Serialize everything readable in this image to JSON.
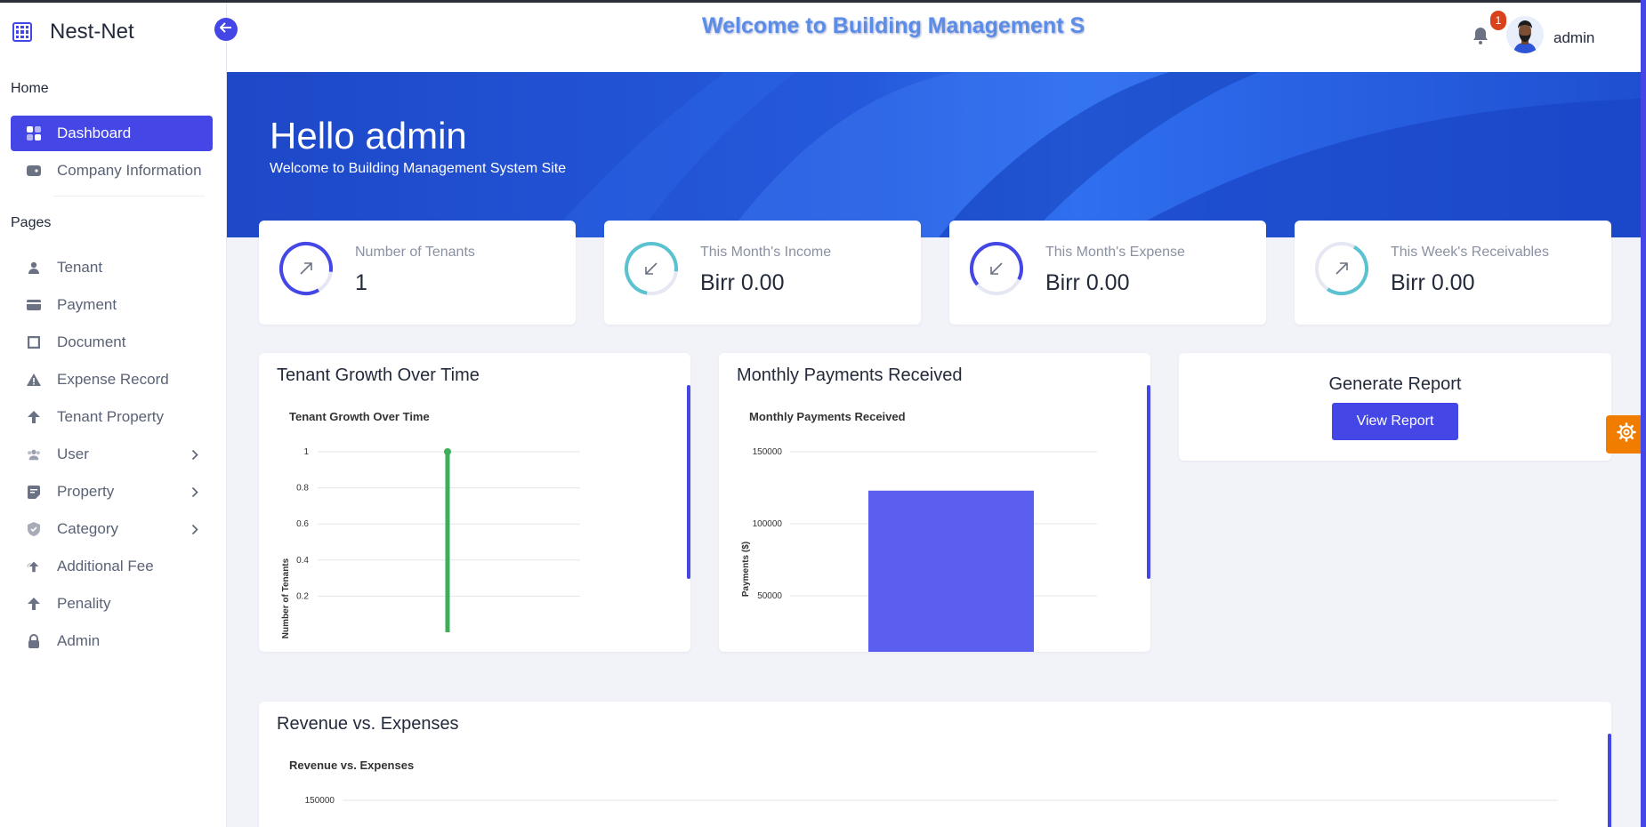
{
  "brand": {
    "name": "Nest-Net",
    "icon": "grid-icon"
  },
  "header": {
    "welcome_text": "Welcome to Building Management System Site",
    "notification_count": "1",
    "user_name": "admin"
  },
  "sidebar": {
    "home_label": "Home",
    "pages_label": "Pages",
    "home_items": [
      {
        "label": "Dashboard",
        "icon": "dashboard-icon",
        "active": true
      },
      {
        "label": "Company Information",
        "icon": "wallet-icon"
      }
    ],
    "page_items": [
      {
        "label": "Tenant",
        "icon": "person-icon"
      },
      {
        "label": "Payment",
        "icon": "card-icon"
      },
      {
        "label": "Document",
        "icon": "square-icon"
      },
      {
        "label": "Expense Record",
        "icon": "warning-icon"
      },
      {
        "label": "Tenant Property",
        "icon": "arrow-up-icon"
      },
      {
        "label": "User",
        "icon": "users-icon",
        "has_submenu": true
      },
      {
        "label": "Property",
        "icon": "note-icon",
        "has_submenu": true
      },
      {
        "label": "Category",
        "icon": "shield-icon",
        "has_submenu": true
      },
      {
        "label": "Additional Fee",
        "icon": "upload-icon"
      },
      {
        "label": "Penality",
        "icon": "arrow-up-icon"
      },
      {
        "label": "Admin",
        "icon": "lock-icon"
      }
    ]
  },
  "hero": {
    "title": "Hello admin",
    "subtitle": "Welcome to Building Management System Site"
  },
  "stats": [
    {
      "label": "Number of Tenants",
      "value": "1",
      "arrow": "up",
      "ring_color": "#4446e6"
    },
    {
      "label": "This Month's Income",
      "value": "Birr 0.00",
      "arrow": "down",
      "ring_color": "#5bc2d1"
    },
    {
      "label": "This Month's Expense",
      "value": "Birr 0.00",
      "arrow": "down",
      "ring_color": "#4446e6"
    },
    {
      "label": "This Week's Receivables",
      "value": "Birr 0.00",
      "arrow": "up",
      "ring_color": "#5bc2d1"
    }
  ],
  "panels": {
    "tenant_growth": {
      "title": "Tenant Growth Over Time"
    },
    "monthly_payments": {
      "title": "Monthly Payments Received"
    },
    "report": {
      "title": "Generate Report",
      "button_label": "View Report"
    },
    "revenue_expenses": {
      "title": "Revenue vs. Expenses"
    }
  },
  "colors": {
    "accent": "#4446e6",
    "notify": "#d9421d",
    "settings_tab": "#f07d00",
    "growth_line": "#3fae5a",
    "payments_bar": "#5a5ff0"
  },
  "chart_data": [
    {
      "type": "line",
      "title": "Tenant Growth Over Time",
      "xlabel": "",
      "ylabel": "Number of Tenants",
      "y_ticks": [
        "1",
        "0.8",
        "0.6",
        "0.4",
        "0.2"
      ],
      "ylim": [
        0,
        1
      ],
      "series": [
        {
          "values": [
            0,
            1
          ]
        }
      ],
      "grid": true
    },
    {
      "type": "bar",
      "title": "Monthly Payments Received",
      "xlabel": "",
      "ylabel": "Payments ($)",
      "y_ticks": [
        "150000",
        "100000",
        "50000"
      ],
      "ylim": [
        0,
        150000
      ],
      "values": [
        123000
      ],
      "grid": true
    },
    {
      "type": "bar",
      "title": "Revenue vs. Expenses",
      "xlabel": "",
      "ylabel": "",
      "y_ticks": [
        "150000"
      ],
      "grid": true
    }
  ]
}
